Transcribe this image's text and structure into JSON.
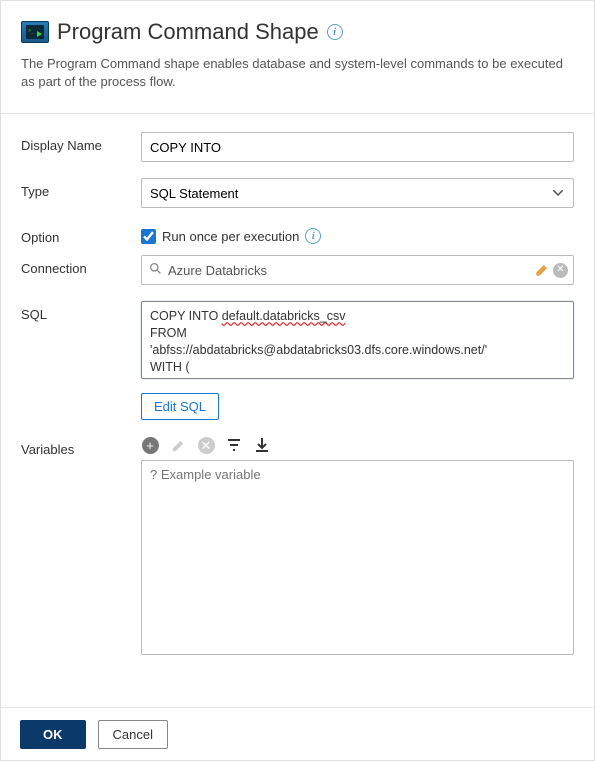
{
  "header": {
    "title": "Program Command Shape",
    "description": "The Program Command shape enables database and system-level commands to be executed as part of the process flow."
  },
  "form": {
    "display_name": {
      "label": "Display Name",
      "value": "COPY INTO"
    },
    "type": {
      "label": "Type",
      "value": "SQL Statement"
    },
    "option": {
      "label": "Option",
      "checkbox_label": "Run once per execution",
      "checked": true
    },
    "connection": {
      "label": "Connection",
      "value": "Azure Databricks"
    },
    "sql": {
      "label": "SQL",
      "line1_prefix": "COPY INTO ",
      "line1_underlined": "default.databricks_csv",
      "line2": "FROM",
      "line3": "'abfss://abdatabricks@abdatabricks03.dfs.core.windows.net/'",
      "line4": "WITH (",
      "edit_button": "Edit SQL"
    },
    "variables": {
      "label": "Variables",
      "placeholder": "? Example variable"
    }
  },
  "footer": {
    "ok": "OK",
    "cancel": "Cancel"
  }
}
